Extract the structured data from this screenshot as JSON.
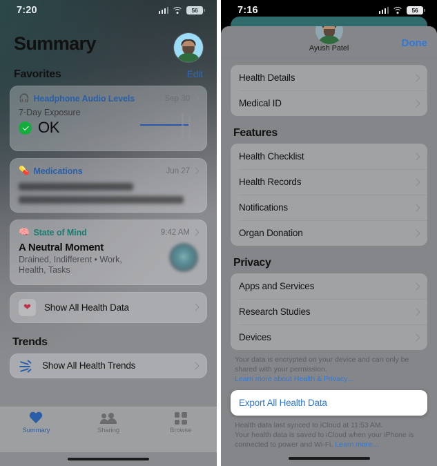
{
  "left_phone": {
    "status_bar": {
      "time": "7:20",
      "battery_percent": "56",
      "cellular_icon": "cellular-bars-icon",
      "wifi_icon": "wifi-icon",
      "battery_icon": "battery-icon"
    },
    "header": {
      "title": "Summary",
      "avatar_name": "profile-avatar"
    },
    "favorites": {
      "section_title": "Favorites",
      "edit_label": "Edit",
      "cards": [
        {
          "icon": "headphone-icon",
          "title": "Headphone Audio Levels",
          "meta": "Sep 30",
          "subtitle": "7-Day Exposure",
          "status": "OK",
          "status_icon": "green-check-icon"
        },
        {
          "icon": "medications-icon",
          "title": "Medications",
          "meta": "Jun 27",
          "redacted_line_1": "creatinine monohydrate,",
          "redacted_line_2": "Homeopathic Pills, and Deflazacort"
        },
        {
          "icon": "state-of-mind-icon",
          "title": "State of Mind",
          "meta": "9:42 AM",
          "mood_title": "A Neutral Moment",
          "mood_detail": "Drained, Indifferent • Work, Health, Tasks"
        }
      ],
      "show_all_row": {
        "icon": "heart-icon",
        "label": "Show All Health Data"
      }
    },
    "trends": {
      "section_title": "Trends",
      "row": {
        "icon": "trends-icon",
        "label": "Show All Health Trends"
      }
    },
    "tab_bar": [
      {
        "label": "Summary",
        "icon": "heart-icon",
        "active": true
      },
      {
        "label": "Sharing",
        "icon": "people-icon",
        "active": false
      },
      {
        "label": "Browse",
        "icon": "grid-icon",
        "active": false
      }
    ]
  },
  "right_phone": {
    "status_bar": {
      "time": "7:16",
      "battery_percent": "56",
      "cellular_icon": "cellular-bars-icon",
      "wifi_icon": "wifi-icon",
      "battery_icon": "battery-icon"
    },
    "sheet_header": {
      "user_name": "Ayush Patel",
      "done_label": "Done",
      "avatar_name": "profile-avatar"
    },
    "groups": [
      {
        "rows": [
          {
            "label": "Health Details"
          },
          {
            "label": "Medical ID"
          }
        ]
      }
    ],
    "features": {
      "section_title": "Features",
      "rows": [
        {
          "label": "Health Checklist"
        },
        {
          "label": "Health Records"
        },
        {
          "label": "Notifications"
        },
        {
          "label": "Organ Donation"
        }
      ]
    },
    "privacy": {
      "section_title": "Privacy",
      "rows": [
        {
          "label": "Apps and Services"
        },
        {
          "label": "Research Studies"
        },
        {
          "label": "Devices"
        }
      ],
      "footer_text": "Your data is encrypted on your device and can only be shared with your permission.",
      "footer_link": "Learn more about Health & Privacy…"
    },
    "export": {
      "label": "Export All Health Data",
      "highlighted": true
    },
    "sync_footer": {
      "line1": "Health data last synced to iCloud at 11:53 AM.",
      "line2": "Your health data is saved to iCloud when your iPhone is connected to power and Wi-Fi.",
      "link": "Learn more…"
    }
  },
  "colors": {
    "accent_blue": "#2f78d6",
    "link_blue": "#2a5fa8",
    "teal": "#197c72",
    "green": "#13ad3d",
    "red": "#c2304a"
  }
}
